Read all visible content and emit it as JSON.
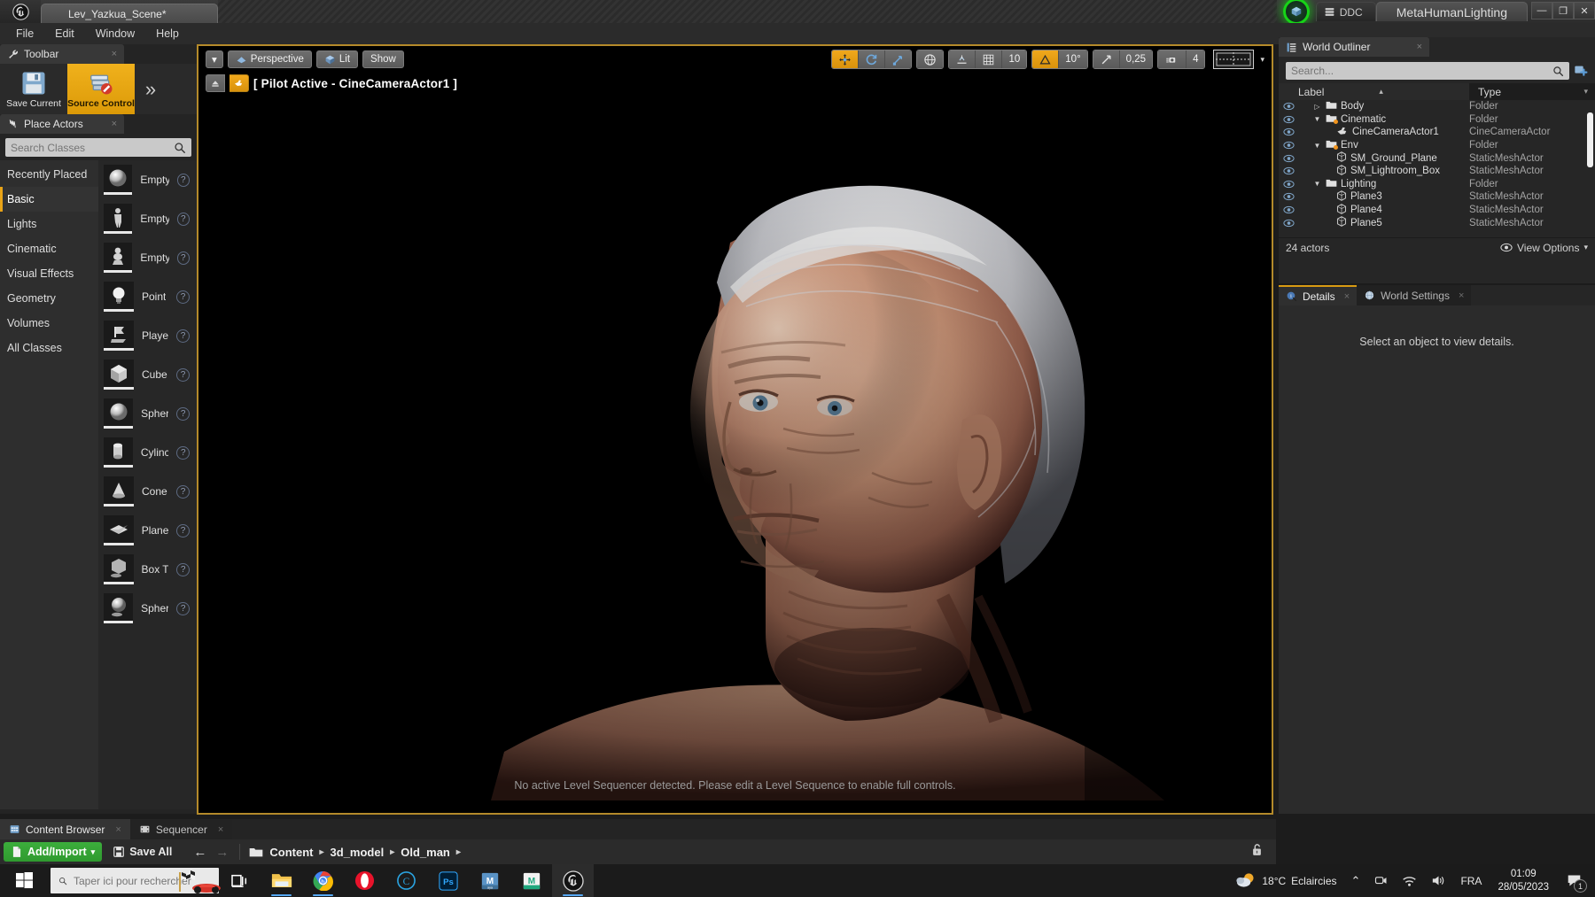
{
  "titlebar": {
    "project_tab": "Lev_Yazkua_Scene*",
    "ddc_label": "DDC",
    "layout_tab": "MetaHumanLighting",
    "minimize": "—",
    "restore": "❐",
    "close": "✕"
  },
  "menu": {
    "items": [
      "File",
      "Edit",
      "Window",
      "Help"
    ]
  },
  "toolbar": {
    "tab_label": "Toolbar",
    "close_x": "×",
    "items": [
      {
        "label": "Save Current",
        "icon": "floppy-disk-icon"
      },
      {
        "label": "Source Control",
        "icon": "source-control-icon"
      }
    ],
    "more": "»"
  },
  "place_actors": {
    "tab_label": "Place Actors",
    "close_x": "×",
    "search_placeholder": "Search Classes",
    "search_value": "",
    "categories": [
      {
        "label": "Recently Placed",
        "selected": false
      },
      {
        "label": "Basic",
        "selected": true
      },
      {
        "label": "Lights",
        "selected": false
      },
      {
        "label": "Cinematic",
        "selected": false
      },
      {
        "label": "Visual Effects",
        "selected": false
      },
      {
        "label": "Geometry",
        "selected": false
      },
      {
        "label": "Volumes",
        "selected": false
      },
      {
        "label": "All Classes",
        "selected": false
      }
    ],
    "actors": [
      {
        "label": "Empty",
        "icon": "sphere-thumb-icon"
      },
      {
        "label": "Empty",
        "icon": "character-thumb-icon"
      },
      {
        "label": "Empty",
        "icon": "pawn-thumb-icon"
      },
      {
        "label": "Point",
        "icon": "pointlight-thumb-icon"
      },
      {
        "label": "Playe",
        "icon": "playerstart-thumb-icon"
      },
      {
        "label": "Cube",
        "icon": "cube-thumb-icon"
      },
      {
        "label": "Spher",
        "icon": "sphere-thumb-icon"
      },
      {
        "label": "Cylinc",
        "icon": "cylinder-thumb-icon"
      },
      {
        "label": "Cone",
        "icon": "cone-thumb-icon"
      },
      {
        "label": "Plane",
        "icon": "plane-thumb-icon"
      },
      {
        "label": "Box T",
        "icon": "boxtrigger-thumb-icon"
      },
      {
        "label": "Spher",
        "icon": "spheretrigger-thumb-icon"
      }
    ],
    "help_glyph": "?"
  },
  "viewport": {
    "menu_caret": "▾",
    "perspective": "Perspective",
    "lit": "Lit",
    "show": "Show",
    "pilot_text": "[ Pilot Active - CineCameraActor1 ]",
    "grid_snap_value": "10",
    "rotation_snap_value": "10°",
    "scale_snap_value": "0,25",
    "camera_speed_value": "4",
    "message": "No active Level Sequencer detected. Please edit a Level Sequence to enable full controls.",
    "layout_caret": "▾"
  },
  "outliner": {
    "tab_label": "World Outliner",
    "close_x": "×",
    "search_placeholder": "Search...",
    "search_value": "",
    "col_label": "Label",
    "col_type": "Type",
    "sort_asc_glyph": "▴",
    "filter_glyph": "▾",
    "rows": [
      {
        "label": "Body",
        "type": "Folder",
        "indent": 1,
        "expander": "collapsed",
        "icon": "folder-icon",
        "modified": false
      },
      {
        "label": "Cinematic",
        "type": "Folder",
        "indent": 1,
        "expander": "expanded",
        "icon": "folder-icon",
        "modified": false
      },
      {
        "label": "CineCameraActor1",
        "type": "CineCameraActor",
        "indent": 2,
        "expander": "none",
        "icon": "camera-icon",
        "modified": true
      },
      {
        "label": "Env",
        "type": "Folder",
        "indent": 1,
        "expander": "expanded",
        "icon": "folder-icon",
        "modified": false
      },
      {
        "label": "SM_Ground_Plane",
        "type": "StaticMeshActor",
        "indent": 2,
        "expander": "none",
        "icon": "mesh-icon",
        "modified": true
      },
      {
        "label": "SM_Lightroom_Box",
        "type": "StaticMeshActor",
        "indent": 2,
        "expander": "none",
        "icon": "mesh-icon",
        "modified": false
      },
      {
        "label": "Lighting",
        "type": "Folder",
        "indent": 1,
        "expander": "expanded",
        "icon": "folder-icon",
        "modified": false
      },
      {
        "label": "Plane3",
        "type": "StaticMeshActor",
        "indent": 2,
        "expander": "none",
        "icon": "mesh-icon",
        "modified": false
      },
      {
        "label": "Plane4",
        "type": "StaticMeshActor",
        "indent": 2,
        "expander": "none",
        "icon": "mesh-icon",
        "modified": false
      },
      {
        "label": "Plane5",
        "type": "StaticMeshActor",
        "indent": 2,
        "expander": "none",
        "icon": "mesh-icon",
        "modified": false
      }
    ],
    "footer_count": "24 actors",
    "view_options": "View Options",
    "view_options_caret": "▾"
  },
  "details": {
    "tabs": [
      {
        "label": "Details",
        "active": true,
        "icon": "details-info-icon"
      },
      {
        "label": "World Settings",
        "active": false,
        "icon": "world-globe-icon"
      }
    ],
    "close_x": "×",
    "empty_message": "Select an object to view details."
  },
  "content_browser": {
    "tabs": [
      {
        "label": "Content Browser",
        "active": true,
        "icon": "content-browser-icon"
      },
      {
        "label": "Sequencer",
        "active": false,
        "icon": "sequencer-icon"
      }
    ],
    "close_x": "×",
    "add_import": "Add/Import",
    "add_caret": "▾",
    "save_all": "Save All",
    "back_arrow": "←",
    "forward_arrow": "→",
    "breadcrumb": [
      "Content",
      "3d_model",
      "Old_man"
    ],
    "breadcrumb_sep": "▸",
    "lock_icon": "unlocked-padlock-icon"
  },
  "taskbar": {
    "search_placeholder": "Taper ici pour rechercher",
    "search_value": "",
    "apps": [
      {
        "name": "task-view-icon",
        "active": false,
        "underline": false
      },
      {
        "name": "file-explorer-icon",
        "active": false,
        "underline": true
      },
      {
        "name": "chrome-icon",
        "active": false,
        "underline": true
      },
      {
        "name": "opera-icon",
        "active": false,
        "underline": false
      },
      {
        "name": "cc-icon",
        "active": false,
        "underline": false
      },
      {
        "name": "photoshop-icon",
        "active": false,
        "underline": false
      },
      {
        "name": "maya-icon",
        "active": false,
        "underline": false
      },
      {
        "name": "marmoset-icon",
        "active": false,
        "underline": false
      },
      {
        "name": "unreal-icon",
        "active": true,
        "underline": true
      }
    ],
    "weather_temp": "18°C",
    "weather_desc": "Eclaircies",
    "chevron_up": "⌃",
    "time": "01:09",
    "date": "28/05/2023",
    "lang": "FRA",
    "notif_count": "1"
  },
  "colors": {
    "accent_orange": "#e8a317",
    "viewport_border": "#b48a2a",
    "green_add": "#2f9a2f",
    "live_coding_green": "#17d417"
  }
}
